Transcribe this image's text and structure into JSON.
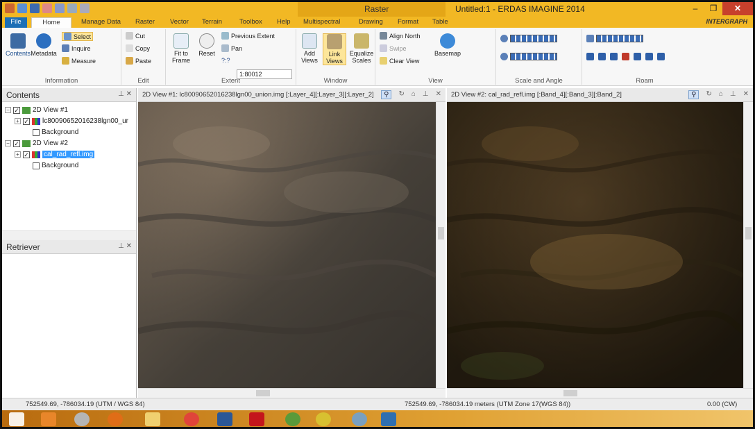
{
  "titlebar": {
    "context_tab": "Raster",
    "window_title": "Untitled:1 - ERDAS IMAGINE 2014",
    "minimize": "–",
    "maximize": "❐",
    "close": "✕"
  },
  "tabs": [
    "File",
    "Home",
    "Manage Data",
    "Raster",
    "Vector",
    "Terrain",
    "Toolbox",
    "Help",
    "Multispectral",
    "Drawing",
    "Format",
    "Table"
  ],
  "brand": "INTERGRAPH",
  "ribbon": {
    "information": {
      "group": "Information",
      "contents": "Contents",
      "metadata": "Metadata"
    },
    "select": {
      "select": "Select",
      "inquire": "Inquire",
      "measure": "Measure"
    },
    "edit": {
      "group": "Edit",
      "cut": "Cut",
      "copy": "Copy",
      "paste": "Paste"
    },
    "extent": {
      "group": "Extent",
      "fit_to_frame": "Fit to Frame",
      "reset": "Reset",
      "previous_extent": "Previous Extent",
      "pan": "Pan",
      "scale_value": "1:80012",
      "unknown": "?:?"
    },
    "window": {
      "group": "Window",
      "add_views": "Add Views",
      "link_views": "Link Views",
      "equalize_scales": "Equalize Scales"
    },
    "view": {
      "group": "View",
      "align_north": "Align North",
      "swipe": "Swipe",
      "clear_view": "Clear View",
      "basemap": "Basemap"
    },
    "scale_angle": {
      "group": "Scale and Angle"
    },
    "roam": {
      "group": "Roam"
    }
  },
  "contents_panel": {
    "title": "Contents",
    "tree": [
      {
        "label": "2D View #1"
      },
      {
        "label": "lc80090652016238lgn00_ur"
      },
      {
        "label": "Background"
      },
      {
        "label": "2D View #2"
      },
      {
        "label": "cal_rad_refl.img"
      },
      {
        "label": "Background"
      }
    ]
  },
  "retriever_panel": {
    "title": "Retriever"
  },
  "view1": {
    "title": "2D View #1: lc80090652016238lgn00_union.img [:Layer_4][:Layer_3][:Layer_2]"
  },
  "view2": {
    "title": "2D View #2: cal_rad_refl.img [:Band_4][:Band_3][:Band_2]"
  },
  "status": {
    "left": "752549.69, -786034.19  (UTM / WGS 84)",
    "middle": "752549.69, -786034.19 meters (UTM Zone 17(WGS 84))",
    "right": "0.00 (CW)"
  },
  "taskbar": {
    "apps": [
      "start",
      "media-player",
      "paint",
      "firefox",
      "file-explorer",
      "chrome",
      "word",
      "acrobat",
      "qgis",
      "envi",
      "arcgis-pro",
      "erdas"
    ]
  },
  "colors": {
    "title": "#f2b824",
    "context": "#e4a617",
    "file_tab": "#1d6fb5",
    "selection": "#3399ff"
  }
}
